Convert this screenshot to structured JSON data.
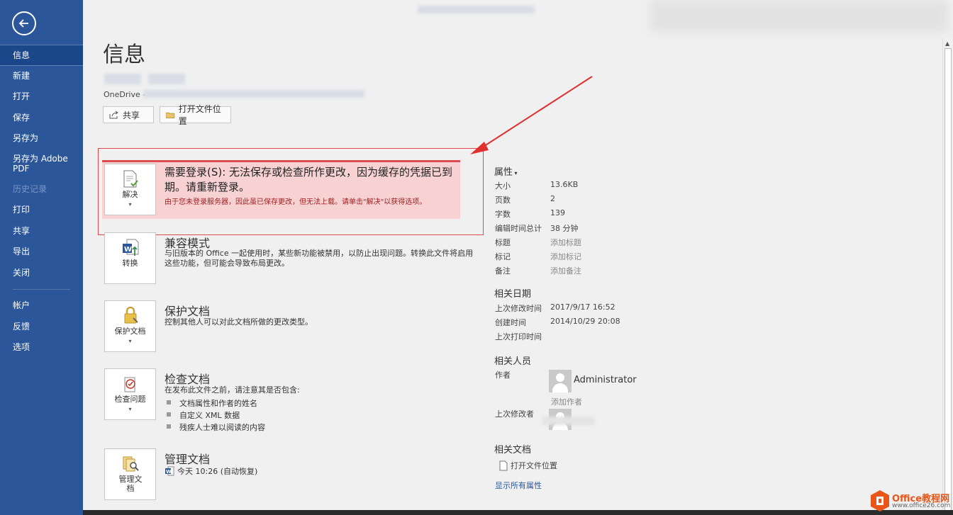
{
  "nav": {
    "items": [
      {
        "label": "信息",
        "state": "active"
      },
      {
        "label": "新建"
      },
      {
        "label": "打开"
      },
      {
        "label": "保存"
      },
      {
        "label": "另存为"
      },
      {
        "label": "另存为 Adobe PDF"
      },
      {
        "label": "历史记录",
        "state": "disabled"
      },
      {
        "label": "打印"
      },
      {
        "label": "共享"
      },
      {
        "label": "导出"
      },
      {
        "label": "关闭"
      }
    ],
    "bottom": [
      {
        "label": "帐户"
      },
      {
        "label": "反馈"
      },
      {
        "label": "选项"
      }
    ]
  },
  "page": {
    "title": "信息",
    "location_prefix": "OneDrive -",
    "share_label": "共享",
    "open_location_label": "打开文件位置"
  },
  "warning": {
    "title": "需要登录(S): 无法保存或检查所作更改，因为缓存的凭据已到期。请重新登录。",
    "desc": "由于您未登录服务器，因此虽已保存更改，但无法上载。请单击\"解决\"以获得选项。",
    "button": "解决"
  },
  "compat": {
    "title": "兼容模式",
    "desc": "与旧版本的 Office 一起使用时，某些新功能被禁用，以防止出现问题。转换此文件将启用这些功能，但可能会导致布局更改。",
    "button": "转换"
  },
  "protect": {
    "title": "保护文档",
    "desc": "控制其他人可以对此文档所做的更改类型。",
    "button": "保护文档"
  },
  "inspect": {
    "title": "检查文档",
    "desc": "在发布此文件之前，请注意其是否包含:",
    "bullets": [
      "文档属性和作者的姓名",
      "自定义 XML 数据",
      "残疾人士难以阅读的内容"
    ],
    "button": "检查问题"
  },
  "manage": {
    "title": "管理文档",
    "version": "今天 10:26 (自动恢复)",
    "button": "管理文档"
  },
  "properties": {
    "header": "属性",
    "rows": [
      {
        "k": "大小",
        "v": "13.6KB"
      },
      {
        "k": "页数",
        "v": "2"
      },
      {
        "k": "字数",
        "v": "139"
      },
      {
        "k": "编辑时间总计",
        "v": "38 分钟"
      },
      {
        "k": "标题",
        "v": "添加标题"
      },
      {
        "k": "标记",
        "v": "添加标记"
      },
      {
        "k": "备注",
        "v": "添加备注"
      }
    ],
    "dates_header": "相关日期",
    "dates": [
      {
        "k": "上次修改时间",
        "v": "2017/9/17 16:52"
      },
      {
        "k": "创建时间",
        "v": "2014/10/29 20:08"
      },
      {
        "k": "上次打印时间",
        "v": ""
      }
    ],
    "people_header": "相关人员",
    "author_label": "作者",
    "author_name": "Administrator",
    "add_author": "添加作者",
    "last_modifier_label": "上次修改者",
    "docs_header": "相关文档",
    "open_location": "打开文件位置",
    "show_all": "显示所有属性"
  },
  "watermark": {
    "brand": "Office教程网",
    "url": "www.office26.com"
  },
  "colors": {
    "sidebar": "#2b579a",
    "warning_bg": "#f8d2d3",
    "warning_border": "#e0484a",
    "link": "#2b579a"
  }
}
